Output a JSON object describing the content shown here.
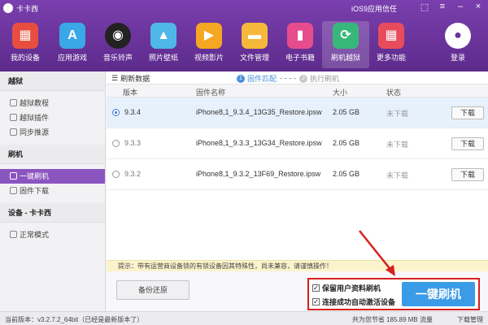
{
  "app": {
    "title": "卡卡西",
    "ios_trust": "iOS9应用信任"
  },
  "toolbar": {
    "items": [
      {
        "label": "我的设备",
        "color": "#e84e40",
        "glyph": "▦"
      },
      {
        "label": "应用游戏",
        "color": "#3aa7e6",
        "glyph": "A"
      },
      {
        "label": "音乐铃声",
        "color": "#222222",
        "glyph": "◉"
      },
      {
        "label": "照片壁纸",
        "color": "#4fb8e8",
        "glyph": "▲"
      },
      {
        "label": "视频影片",
        "color": "#f5a623",
        "glyph": "▶"
      },
      {
        "label": "文件管理",
        "color": "#f6b83b",
        "glyph": "▬"
      },
      {
        "label": "电子书籍",
        "color": "#e74c8c",
        "glyph": "▮"
      },
      {
        "label": "刷机越狱",
        "color": "#37b87a",
        "glyph": "⟳"
      },
      {
        "label": "更多功能",
        "color": "#e74c5c",
        "glyph": "▦"
      }
    ],
    "login": "登录"
  },
  "sidebar": {
    "groups": [
      {
        "title": "越狱",
        "items": [
          "越狱教程",
          "越狱插件",
          "同步推源"
        ]
      },
      {
        "title": "刷机",
        "items": [
          "一键刷机",
          "固件下载"
        ]
      },
      {
        "title": "设备 - 卡卡西",
        "items": [
          "正常模式"
        ]
      }
    ]
  },
  "main": {
    "refresh": "刷新数据",
    "step1": {
      "num": "1",
      "label": "固件匹配"
    },
    "step2": {
      "num": "2",
      "label": "执行刷机"
    },
    "columns": {
      "version": "版本",
      "firmware": "固件名称",
      "size": "大小",
      "status": "状态"
    },
    "rows": [
      {
        "version": "9.3.4",
        "firmware": "iPhone8,1_9.3.4_13G35_Restore.ipsw",
        "size": "2.05 GB",
        "status": "未下载",
        "action": "下载"
      },
      {
        "version": "9.3.3",
        "firmware": "iPhone8,1_9.3.3_13G34_Restore.ipsw",
        "size": "2.05 GB",
        "status": "未下载",
        "action": "下载"
      },
      {
        "version": "9.3.2",
        "firmware": "iPhone8,1_9.3.2_13F69_Restore.ipsw",
        "size": "2.05 GB",
        "status": "未下载",
        "action": "下载"
      }
    ],
    "tip": "提示：带有运营商设备锁的有锁设备因其特殊性，尚未兼容，请谨慎操作！",
    "backup_button": "备份还原",
    "option_keep_data": "保留用户资料刷机",
    "option_auto_activate": "连接成功自动激活设备",
    "flash_button": "一键刷机"
  },
  "statusbar": {
    "version": "当前版本：v3.2.7.2_64bit（已经是最新版本了）",
    "saved": "共为您节省 185.89 MB 流量",
    "download_manager": "下载管理"
  }
}
